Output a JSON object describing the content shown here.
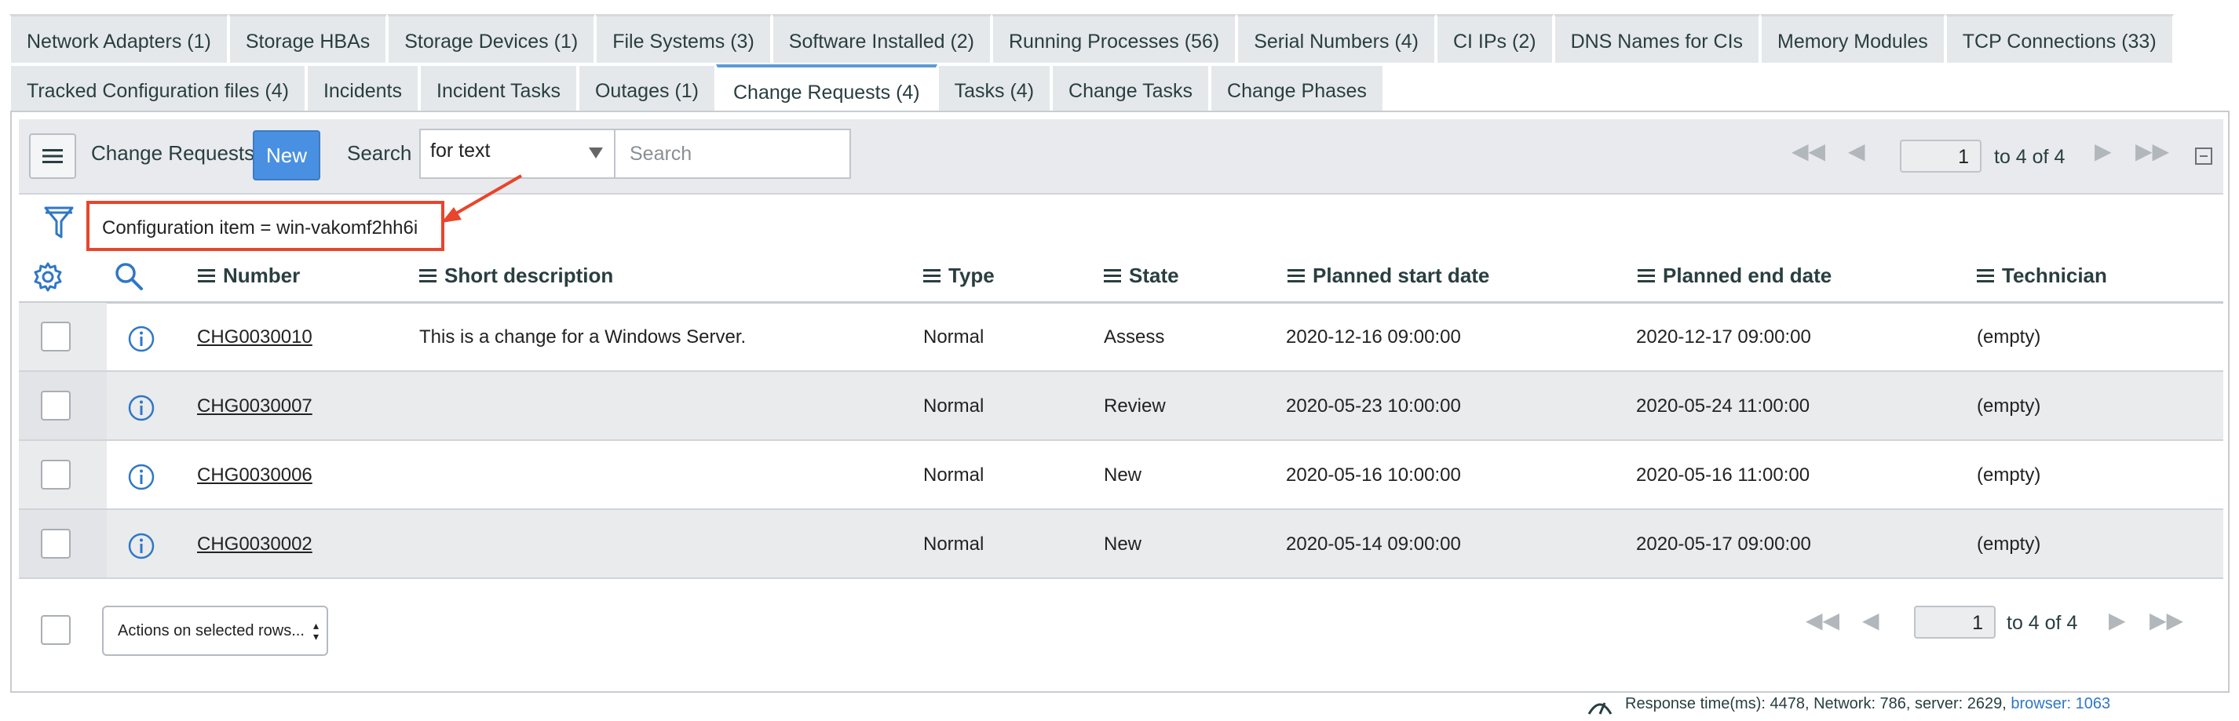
{
  "tabs_row1": [
    {
      "label": "Network Adapters (1)"
    },
    {
      "label": "Storage HBAs"
    },
    {
      "label": "Storage Devices (1)"
    },
    {
      "label": "File Systems (3)"
    },
    {
      "label": "Software Installed (2)"
    },
    {
      "label": "Running Processes (56)"
    },
    {
      "label": "Serial Numbers (4)"
    },
    {
      "label": "CI IPs (2)"
    },
    {
      "label": "DNS Names for CIs"
    },
    {
      "label": "Memory Modules"
    },
    {
      "label": "TCP Connections (33)"
    }
  ],
  "tabs_row2": [
    {
      "label": "Tracked Configuration files (4)"
    },
    {
      "label": "Incidents"
    },
    {
      "label": "Incident Tasks"
    },
    {
      "label": "Outages (1)"
    },
    {
      "label": "Change Requests (4)",
      "active": true
    },
    {
      "label": "Tasks (4)"
    },
    {
      "label": "Change Tasks"
    },
    {
      "label": "Change Phases"
    }
  ],
  "toolbar": {
    "title": "Change Requests",
    "new_label": "New",
    "search_label": "Search",
    "search_field_value": "for text",
    "search_placeholder": "Search",
    "page_value": "1",
    "page_of": "to 4 of 4"
  },
  "filter": {
    "breadcrumb": "Configuration item = win-vakomf2hh6i"
  },
  "columns": {
    "number": "Number",
    "short_description": "Short description",
    "type": "Type",
    "state": "State",
    "planned_start": "Planned start date",
    "planned_end": "Planned end date",
    "technician": "Technician"
  },
  "rows": [
    {
      "number": "CHG0030010",
      "short_description": "This is a change for a Windows Server.",
      "type": "Normal",
      "state": "Assess",
      "planned_start": "2020-12-16 09:00:00",
      "planned_end": "2020-12-17 09:00:00",
      "technician": "(empty)"
    },
    {
      "number": "CHG0030007",
      "short_description": "",
      "type": "Normal",
      "state": "Review",
      "planned_start": "2020-05-23 10:00:00",
      "planned_end": "2020-05-24 11:00:00",
      "technician": "(empty)"
    },
    {
      "number": "CHG0030006",
      "short_description": "",
      "type": "Normal",
      "state": "New",
      "planned_start": "2020-05-16 10:00:00",
      "planned_end": "2020-05-16 11:00:00",
      "technician": "(empty)"
    },
    {
      "number": "CHG0030002",
      "short_description": "",
      "type": "Normal",
      "state": "New",
      "planned_start": "2020-05-14 09:00:00",
      "planned_end": "2020-05-17 09:00:00",
      "technician": "(empty)"
    }
  ],
  "footer": {
    "actions_label": "Actions on selected rows...",
    "page_value": "1",
    "page_of": "to 4 of 4"
  },
  "status_bar": {
    "text": "Response time(ms): 4478, Network: 786, server: 2629,",
    "browser_link": "browser: 1063"
  },
  "colors": {
    "accent": "#4a90e2",
    "highlight_box": "#e8452c",
    "icon_blue": "#2f77c6"
  }
}
